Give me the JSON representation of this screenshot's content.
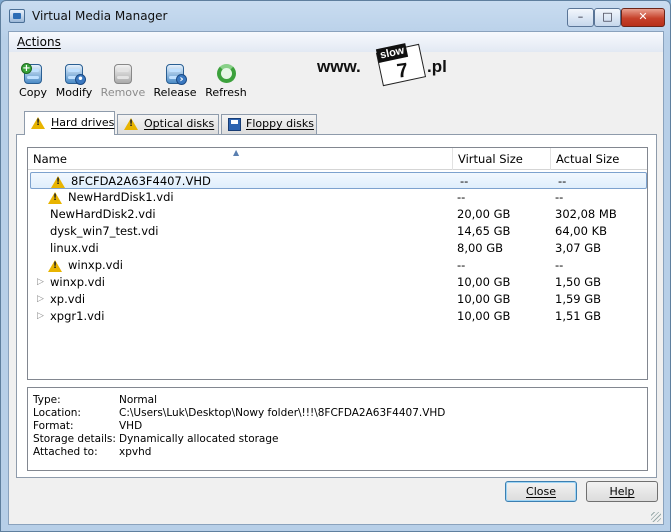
{
  "window": {
    "title": "Virtual Media Manager"
  },
  "menu": {
    "items": [
      {
        "label": "Actions"
      }
    ]
  },
  "toolbar": {
    "copy": {
      "label": "Copy",
      "icon": "disk-copy-icon"
    },
    "modify": {
      "label": "Modify",
      "icon": "disk-modify-icon"
    },
    "remove": {
      "label": "Remove",
      "icon": "disk-remove-icon",
      "disabled": true
    },
    "release": {
      "label": "Release",
      "icon": "disk-release-icon"
    },
    "refresh": {
      "label": "Refresh",
      "icon": "refresh-icon"
    }
  },
  "logo": {
    "prefix": "www.",
    "tag": "slow",
    "digit": "7",
    "suffix": ".pl"
  },
  "tabs": [
    {
      "label": "Hard drives",
      "icon": "warning-icon",
      "active": true
    },
    {
      "label": "Optical disks",
      "icon": "warning-icon",
      "active": false
    },
    {
      "label": "Floppy disks",
      "icon": "floppy-icon",
      "active": false
    }
  ],
  "grid": {
    "columns": {
      "name": "Name",
      "virtual": "Virtual Size",
      "actual": "Actual Size"
    },
    "rows": [
      {
        "name": "8FCFDA2A63F4407.VHD",
        "virtual": "--",
        "actual": "--",
        "warning": true,
        "selected": true,
        "expandable": false
      },
      {
        "name": "NewHardDisk1.vdi",
        "virtual": "--",
        "actual": "--",
        "warning": true,
        "selected": false,
        "expandable": false
      },
      {
        "name": "NewHardDisk2.vdi",
        "virtual": "20,00 GB",
        "actual": "302,08 MB",
        "warning": false,
        "selected": false,
        "expandable": false
      },
      {
        "name": "dysk_win7_test.vdi",
        "virtual": "14,65 GB",
        "actual": "64,00 KB",
        "warning": false,
        "selected": false,
        "expandable": false
      },
      {
        "name": "linux.vdi",
        "virtual": "8,00 GB",
        "actual": "3,07 GB",
        "warning": false,
        "selected": false,
        "expandable": false
      },
      {
        "name": "winxp.vdi",
        "virtual": "--",
        "actual": "--",
        "warning": true,
        "selected": false,
        "expandable": false
      },
      {
        "name": "winxp.vdi",
        "virtual": "10,00 GB",
        "actual": "1,50 GB",
        "warning": false,
        "selected": false,
        "expandable": true
      },
      {
        "name": "xp.vdi",
        "virtual": "10,00 GB",
        "actual": "1,59 GB",
        "warning": false,
        "selected": false,
        "expandable": true
      },
      {
        "name": "xpgr1.vdi",
        "virtual": "10,00 GB",
        "actual": "1,51 GB",
        "warning": false,
        "selected": false,
        "expandable": true
      }
    ]
  },
  "details": {
    "type": {
      "key": "Type:",
      "value": "Normal"
    },
    "location": {
      "key": "Location:",
      "value": "C:\\Users\\Luk\\Desktop\\Nowy folder\\!!!\\8FCFDA2A63F4407.VHD"
    },
    "format": {
      "key": "Format:",
      "value": "VHD"
    },
    "storage": {
      "key": "Storage details:",
      "value": "Dynamically allocated storage"
    },
    "attached": {
      "key": "Attached to:",
      "value": "xpvhd"
    }
  },
  "buttons": {
    "close": "Close",
    "help": "Help"
  },
  "colors": {
    "selection_border": "#7da2ce",
    "warning": "#e8b400",
    "title_close": "#c6412a"
  }
}
